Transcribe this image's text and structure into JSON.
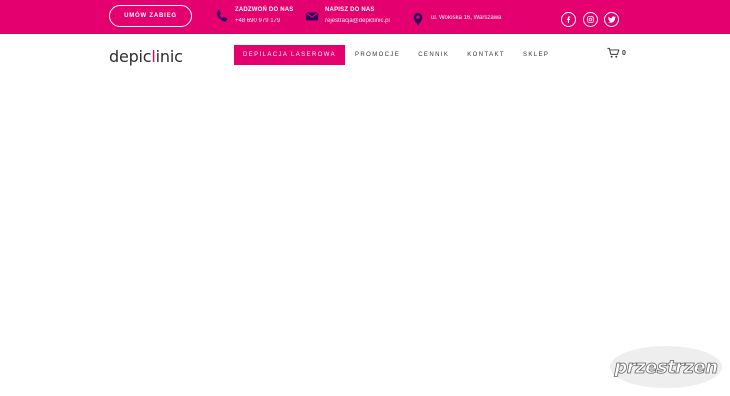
{
  "topbar": {
    "book_label": "UMÓW ZABIEG",
    "phone": {
      "title": "ZADZWOŃ DO NAS",
      "value": "+48 690 979 179",
      "icon": "phone-icon"
    },
    "email": {
      "title": "NAPISZ DO NAS",
      "value": "rejestracja@depiclinic.pl",
      "icon": "envelope-icon"
    },
    "address": {
      "value": "ul. Wołoska 16, Warszawa",
      "icon": "map-pin-icon"
    },
    "social": [
      "facebook-icon",
      "instagram-icon",
      "twitter-icon"
    ],
    "bar_color": "#e4006e"
  },
  "header": {
    "logo_start": "depic",
    "logo_accent": "l",
    "logo_end": "inic",
    "nav": [
      {
        "label": "DEPILACJA LASEROWA",
        "active": true
      },
      {
        "label": "PROMOCJE",
        "active": false
      },
      {
        "label": "CENNIK",
        "active": false
      },
      {
        "label": "KONTAKT",
        "active": false
      },
      {
        "label": "SKLEP",
        "active": false
      }
    ],
    "cart_count": "0"
  },
  "watermark": {
    "text": "przestrzen"
  }
}
